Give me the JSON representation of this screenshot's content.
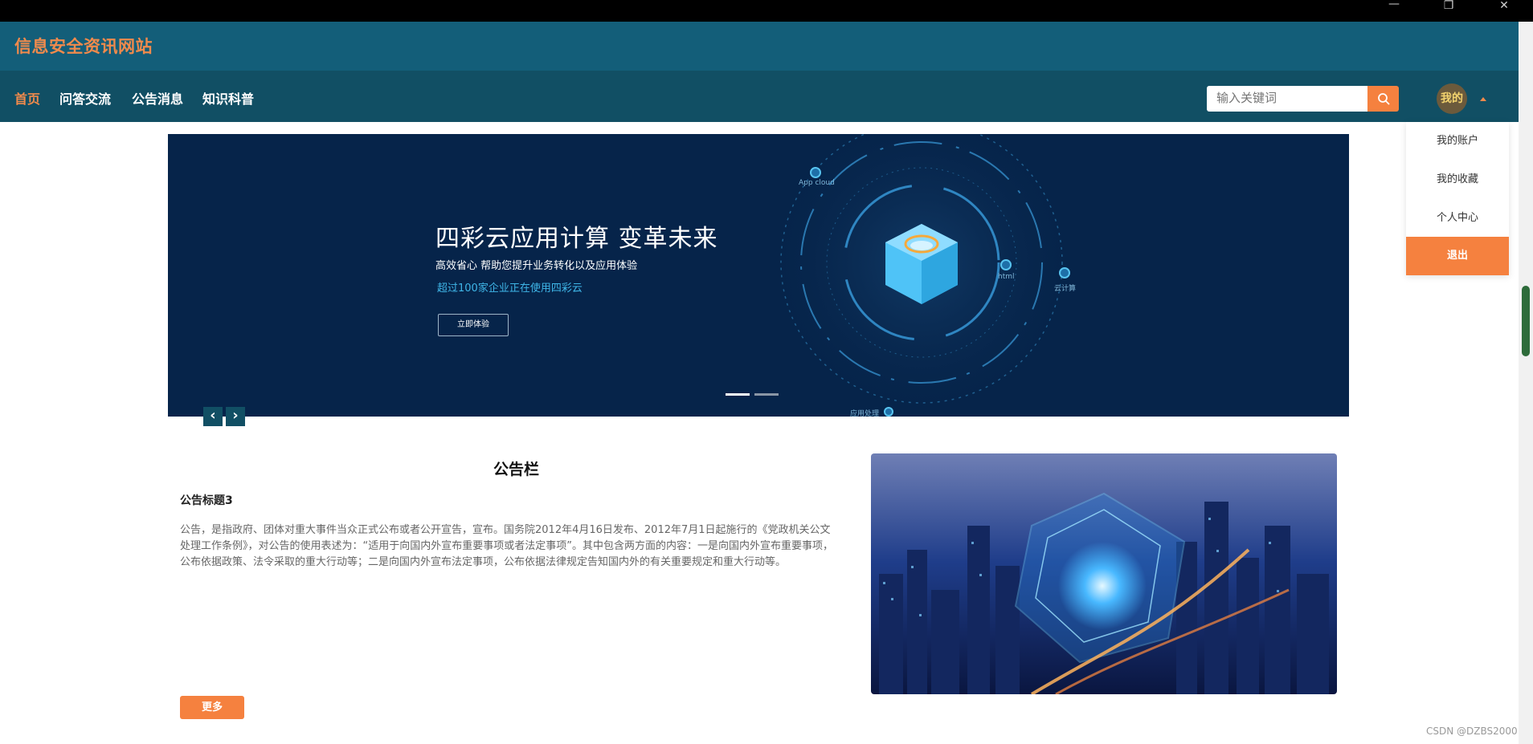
{
  "window": {
    "minimize": "—",
    "restore": "❐",
    "close": "✕"
  },
  "header": {
    "site_title": "信息安全资讯网站"
  },
  "nav": {
    "items": [
      {
        "label": "首页",
        "active": true
      },
      {
        "label": "问答交流"
      },
      {
        "label": "公告消息"
      },
      {
        "label": "知识科普"
      }
    ],
    "search_placeholder": "输入关键词",
    "avatar_label": "我的"
  },
  "dropdown": {
    "items": [
      "我的账户",
      "我的收藏",
      "个人中心"
    ],
    "logout": "退出"
  },
  "banner": {
    "title": "四彩云应用计算 变革未来",
    "sub1": "高效省心 帮助您提升业务转化以及应用体验",
    "sub2": "超过100家企业正在使用四彩云",
    "button": "立即体验",
    "labels": [
      "App cloud",
      "html",
      "云计算",
      "应用处理"
    ]
  },
  "arrows": {
    "prev": "‹",
    "next": "›"
  },
  "notice": {
    "title": "公告栏",
    "item_title": "公告标题3",
    "body": "公告，是指政府、团体对重大事件当众正式公布或者公开宣告，宣布。国务院2012年4月16日发布、2012年7月1日起施行的《党政机关公文处理工作条例》，对公告的使用表述为：“适用于向国内外宣布重要事项或者法定事项”。其中包含两方面的内容：一是向国内外宣布重要事项，公布依据政策、法令采取的重大行动等；二是向国内外宣布法定事项，公布依据法律规定告知国内外的有关重要规定和重大行动等。",
    "more": "更多"
  },
  "watermark": "CSDN @DZBS2000",
  "colors": {
    "accent": "#f5813f",
    "header_bg": "#135e79",
    "nav_bg": "#114f64"
  }
}
